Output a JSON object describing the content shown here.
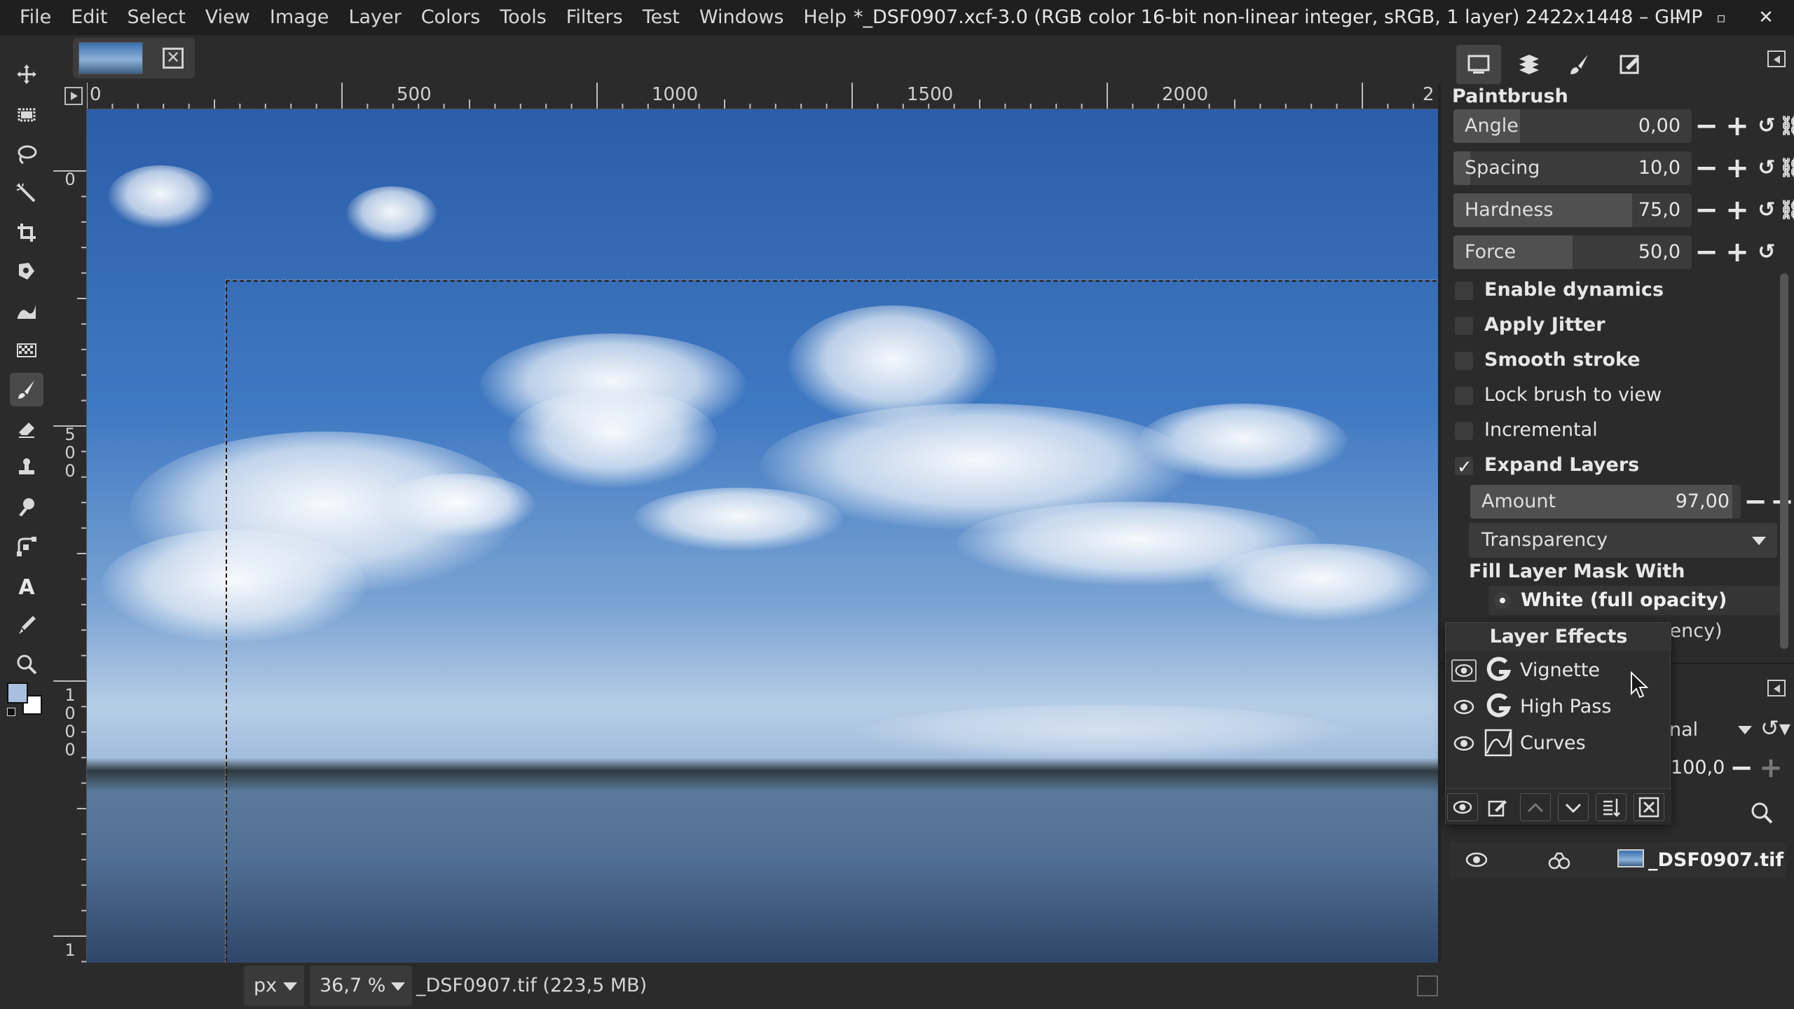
{
  "menubar": {
    "items": [
      "File",
      "Edit",
      "Select",
      "View",
      "Image",
      "Layer",
      "Colors",
      "Tools",
      "Filters",
      "Test",
      "Windows",
      "Help"
    ]
  },
  "window": {
    "title": "*_DSF0907.xcf-3.0 (RGB color 16-bit non-linear integer, sRGB, 1 layer) 2422x1448 – GIMP",
    "minimize": "–",
    "maximize": "▫",
    "close": "✕"
  },
  "image_tab": {
    "close_glyph": "✕"
  },
  "rulers": {
    "horizontal": [
      "0",
      "500",
      "1000",
      "1500",
      "2000",
      "2"
    ],
    "vertical": [
      [
        "0"
      ],
      [
        "5",
        "0",
        "0"
      ],
      [
        "1",
        "0",
        "0",
        "0"
      ],
      [
        "1"
      ]
    ]
  },
  "statusbar": {
    "unit": "px",
    "zoom": "36,7 %",
    "info": "_DSF0907.tif (223,5 MB)"
  },
  "tool_options": {
    "title": "Paintbrush",
    "sliders": [
      {
        "label": "Angle",
        "value": "0,00",
        "fill": 0.28
      },
      {
        "label": "Spacing",
        "value": "10,0",
        "fill": 0.07
      },
      {
        "label": "Hardness",
        "value": "75,0",
        "fill": 0.75
      },
      {
        "label": "Force",
        "value": "50,0",
        "fill": 0.5
      }
    ],
    "checkboxes": [
      {
        "label": "Enable dynamics",
        "checked": false,
        "bold": true
      },
      {
        "label": "Apply Jitter",
        "checked": false,
        "bold": true
      },
      {
        "label": "Smooth stroke",
        "checked": false,
        "bold": true
      },
      {
        "label": "Lock brush to view",
        "checked": false,
        "bold": false
      },
      {
        "label": "Incremental",
        "checked": false,
        "bold": false
      },
      {
        "label": "Expand Layers",
        "checked": true,
        "bold": true
      }
    ],
    "amount": {
      "label": "Amount",
      "value": "97,00",
      "fill": 0.97
    },
    "transparency_combo": "Transparency",
    "fill_mask_title": "Fill Layer Mask With",
    "radio_selected": "White (full opacity)",
    "radio_other_tail": "rency)"
  },
  "layers": {
    "mode_tail": "nal",
    "opacity_tail": "100,0",
    "layer_name": "_DSF0907.tif"
  },
  "layer_effects": {
    "title": "Layer Effects",
    "items": [
      {
        "name": "Vignette",
        "icon": "gegl-icon"
      },
      {
        "name": "High Pass",
        "icon": "gegl-icon"
      },
      {
        "name": "Curves",
        "icon": "curves-icon"
      }
    ]
  },
  "buttons": {
    "minus": "−",
    "plus": "+"
  },
  "colors": {
    "accent": "#4a4a4a",
    "bg": "#2b2b2b",
    "titlebar": "#1f1f1f"
  }
}
